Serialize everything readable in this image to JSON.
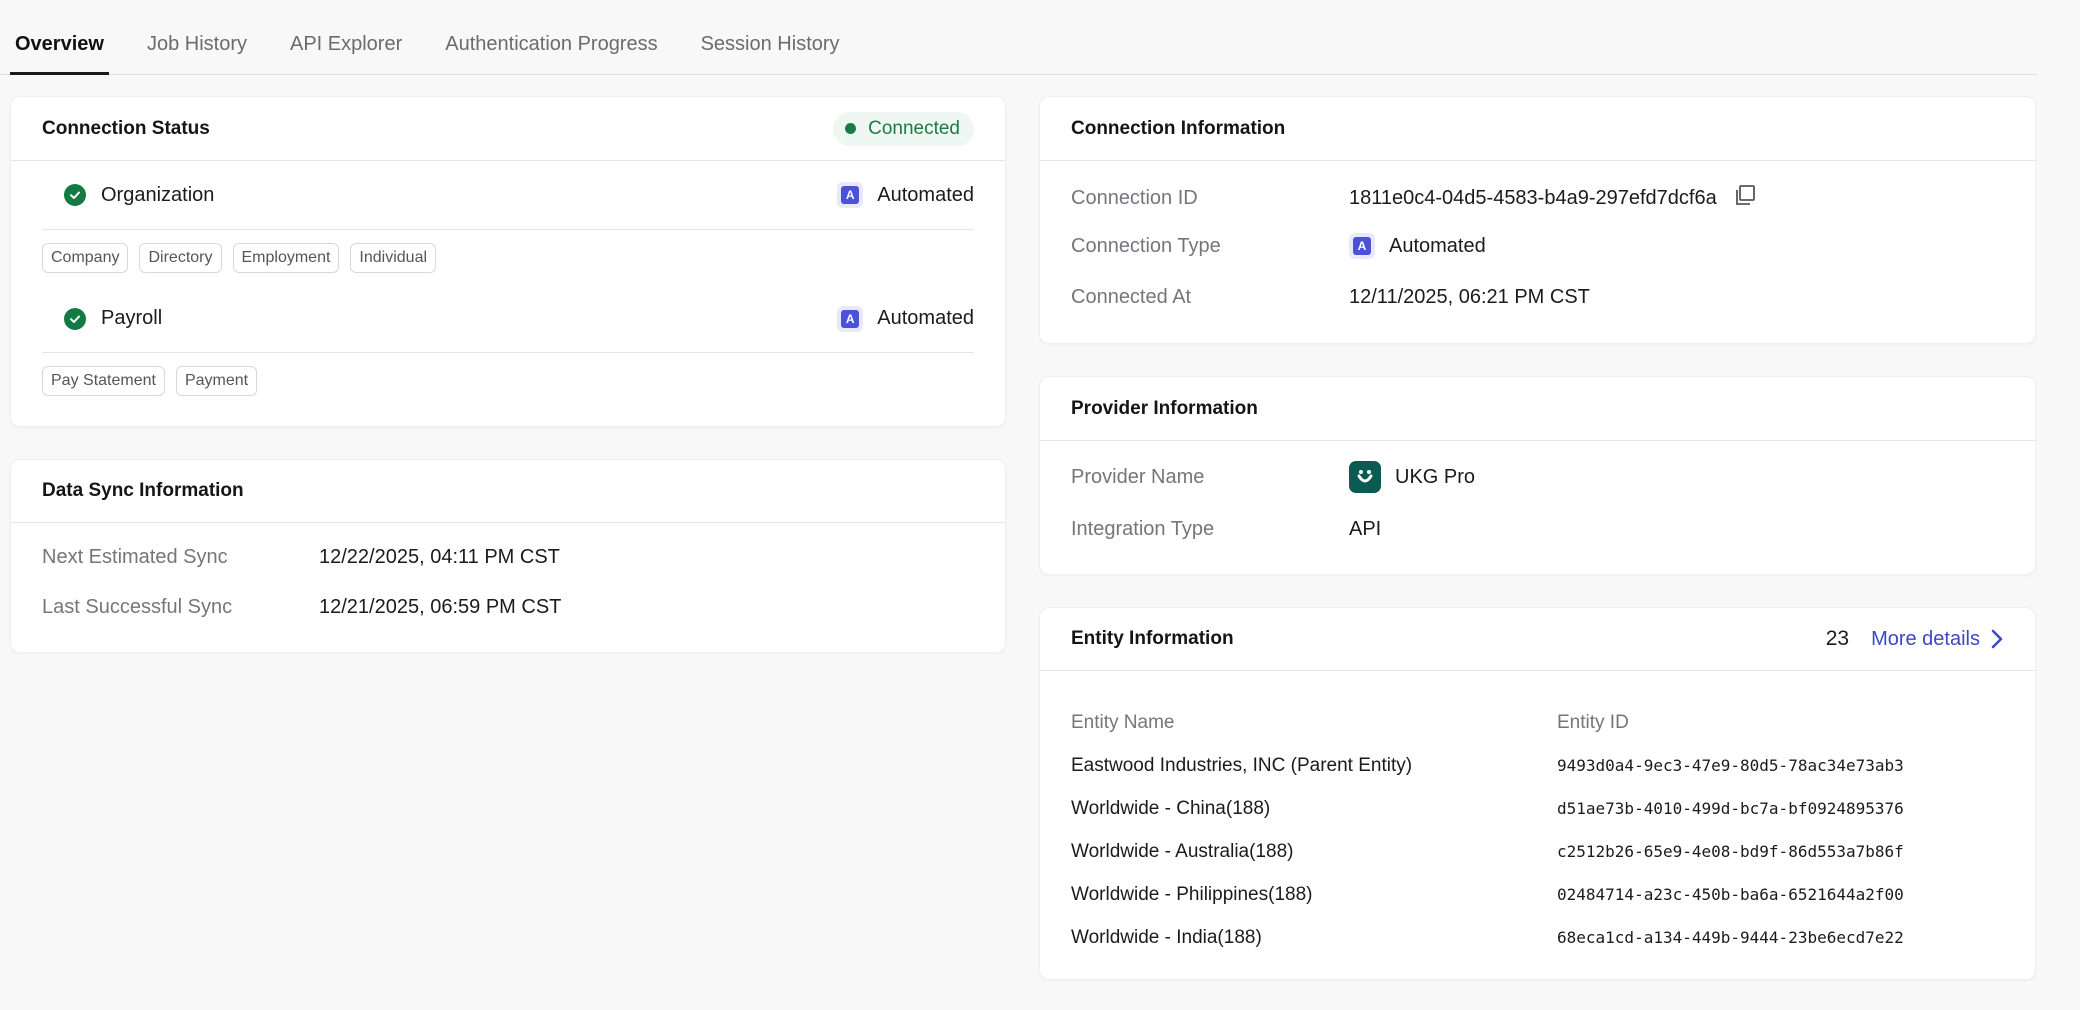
{
  "tabs": [
    {
      "label": "Overview",
      "active": true
    },
    {
      "label": "Job History"
    },
    {
      "label": "API Explorer"
    },
    {
      "label": "Authentication Progress"
    },
    {
      "label": "Session History"
    }
  ],
  "connection_status": {
    "title": "Connection Status",
    "status": "Connected",
    "status_color": "#187a45",
    "products": [
      {
        "name": "Organization",
        "mode": "Automated",
        "badge": "A",
        "scopes": [
          "Company",
          "Directory",
          "Employment",
          "Individual"
        ]
      },
      {
        "name": "Payroll",
        "mode": "Automated",
        "badge": "A",
        "scopes": [
          "Pay Statement",
          "Payment"
        ]
      }
    ]
  },
  "data_sync": {
    "title": "Data Sync Information",
    "next_label": "Next Estimated Sync",
    "next_value": "12/22/2025, 04:11 PM CST",
    "last_label": "Last Successful Sync",
    "last_value": "12/21/2025, 06:59 PM CST"
  },
  "connection_info": {
    "title": "Connection Information",
    "id_label": "Connection ID",
    "id_value": "1811e0c4-04d5-4583-b4a9-297efd7dcf6a",
    "type_label": "Connection Type",
    "type_value": "Automated",
    "type_badge": "A",
    "connected_label": "Connected At",
    "connected_value": "12/11/2025, 06:21 PM CST"
  },
  "provider_info": {
    "title": "Provider Information",
    "name_label": "Provider Name",
    "name_value": "UKG Pro",
    "integration_label": "Integration Type",
    "integration_value": "API"
  },
  "entity_info": {
    "title": "Entity Information",
    "count": "23",
    "more_label": "More details",
    "col_name": "Entity Name",
    "col_id": "Entity ID",
    "rows": [
      {
        "name": "Eastwood Industries, INC (Parent Entity)",
        "id": "9493d0a4-9ec3-47e9-80d5-78ac34e73ab3"
      },
      {
        "name": "Worldwide - China(188)",
        "id": "d51ae73b-4010-499d-bc7a-bf0924895376"
      },
      {
        "name": "Worldwide - Australia(188)",
        "id": "c2512b26-65e9-4e08-bd9f-86d553a7b86f"
      },
      {
        "name": "Worldwide - Philippines(188)",
        "id": "02484714-a23c-450b-ba6a-6521644a2f00"
      },
      {
        "name": "Worldwide - India(188)",
        "id": "68eca1cd-a134-449b-9444-23be6ecd7e22"
      }
    ]
  },
  "colors": {
    "accent": "#3b47c9",
    "success": "#147a45",
    "badge": "#4a52d8"
  }
}
